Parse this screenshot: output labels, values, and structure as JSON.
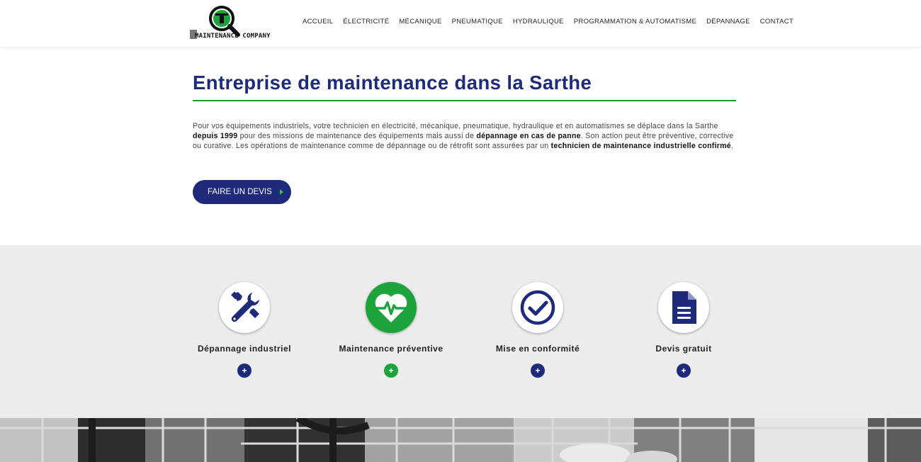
{
  "header": {
    "logo_text": "MAINTENANCE COMPANY",
    "nav": [
      "ACCUEIL",
      "ÉLECTRICITÉ",
      "MÉCANIQUE",
      "PNEUMATIQUE",
      "HYDRAULIQUE",
      "PROGRAMMATION & AUTOMATISME",
      "DÉPANNAGE",
      "CONTACT"
    ]
  },
  "intro": {
    "title": "Entreprise de maintenance dans la Sarthe",
    "p1": "Pour vos équipements industriels, votre technicien en électricité, mécanique, pneumatique, hydraulique et en automatismes se déplace dans la Sarthe ",
    "b1": "depuis 1999",
    "p2": " pour des missions de maintenance des équipements mais aussi de ",
    "b2": "dépannage en cas de panne",
    "p3": ". Son action peut être préventive, corrective ou curative. Les opérations de maintenance comme de dépannage ou de rétrofit sont assurées par un ",
    "b3": "technicien de maintenance industrielle confirmé",
    "p4": "."
  },
  "cta": {
    "label": "FAIRE UN DEVIS"
  },
  "features": [
    {
      "title": "Dépannage industriel",
      "icon": "tools-icon"
    },
    {
      "title": "Maintenance préventive",
      "icon": "heartbeat-icon"
    },
    {
      "title": "Mise en conformité",
      "icon": "check-circle-icon"
    },
    {
      "title": "Devis gratuit",
      "icon": "document-icon"
    }
  ],
  "plus_symbol": "+",
  "colors": {
    "navy": "#1e2a7a",
    "green": "#1da33b",
    "band": "#ececec"
  }
}
